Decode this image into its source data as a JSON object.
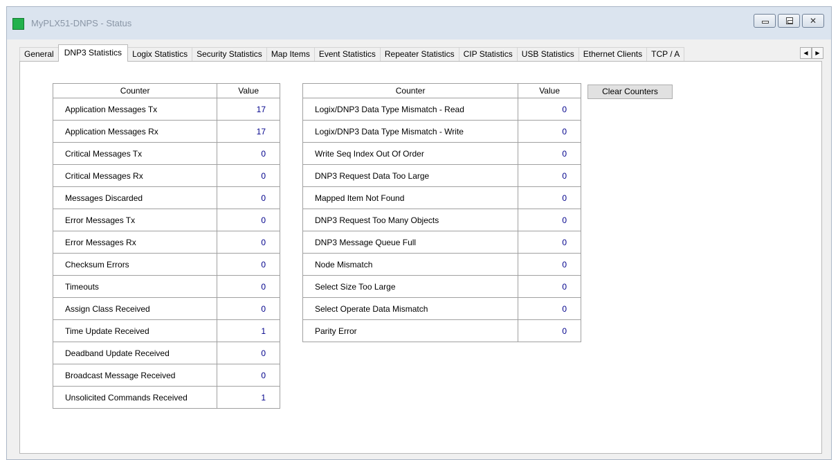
{
  "window": {
    "title": "MyPLX51-DNPS - Status",
    "controls": {
      "minimize": "minimize",
      "maximize": "maximize",
      "close": "✕"
    }
  },
  "colors": {
    "value_text": "#00008b",
    "app_icon": "#22b14c"
  },
  "tabs": [
    {
      "label": "General"
    },
    {
      "label": "DNP3 Statistics",
      "active": true
    },
    {
      "label": "Logix Statistics"
    },
    {
      "label": "Security Statistics"
    },
    {
      "label": "Map Items"
    },
    {
      "label": "Event Statistics"
    },
    {
      "label": "Repeater Statistics"
    },
    {
      "label": "CIP Statistics"
    },
    {
      "label": "USB Statistics"
    },
    {
      "label": "Ethernet Clients"
    },
    {
      "label": "TCP / A"
    }
  ],
  "tab_scroll": {
    "left": "◀",
    "right": "▶"
  },
  "left_table": {
    "headers": {
      "counter": "Counter",
      "value": "Value"
    },
    "rows": [
      {
        "counter": "Application Messages Tx",
        "value": "17"
      },
      {
        "counter": "Application Messages Rx",
        "value": "17"
      },
      {
        "counter": "Critical Messages Tx",
        "value": "0"
      },
      {
        "counter": "Critical Messages Rx",
        "value": "0"
      },
      {
        "counter": "Messages Discarded",
        "value": "0"
      },
      {
        "counter": "Error Messages Tx",
        "value": "0"
      },
      {
        "counter": "Error Messages Rx",
        "value": "0"
      },
      {
        "counter": "Checksum Errors",
        "value": "0"
      },
      {
        "counter": "Timeouts",
        "value": "0"
      },
      {
        "counter": "Assign Class Received",
        "value": "0"
      },
      {
        "counter": "Time Update Received",
        "value": "1"
      },
      {
        "counter": "Deadband Update Received",
        "value": "0"
      },
      {
        "counter": "Broadcast Message Received",
        "value": "0"
      },
      {
        "counter": "Unsolicited Commands Received",
        "value": "1"
      }
    ]
  },
  "right_table": {
    "headers": {
      "counter": "Counter",
      "value": "Value"
    },
    "rows": [
      {
        "counter": "Logix/DNP3 Data Type Mismatch - Read",
        "value": "0"
      },
      {
        "counter": "Logix/DNP3 Data Type Mismatch - Write",
        "value": "0"
      },
      {
        "counter": "Write Seq Index Out Of Order",
        "value": "0"
      },
      {
        "counter": "DNP3 Request Data Too Large",
        "value": "0"
      },
      {
        "counter": "Mapped Item Not Found",
        "value": "0"
      },
      {
        "counter": "DNP3 Request Too Many Objects",
        "value": "0"
      },
      {
        "counter": "DNP3 Message Queue Full",
        "value": "0"
      },
      {
        "counter": "Node Mismatch",
        "value": "0"
      },
      {
        "counter": "Select Size Too Large",
        "value": "0"
      },
      {
        "counter": "Select Operate Data Mismatch",
        "value": "0"
      },
      {
        "counter": "Parity Error",
        "value": "0"
      }
    ]
  },
  "clear_button": {
    "label": "Clear Counters"
  }
}
